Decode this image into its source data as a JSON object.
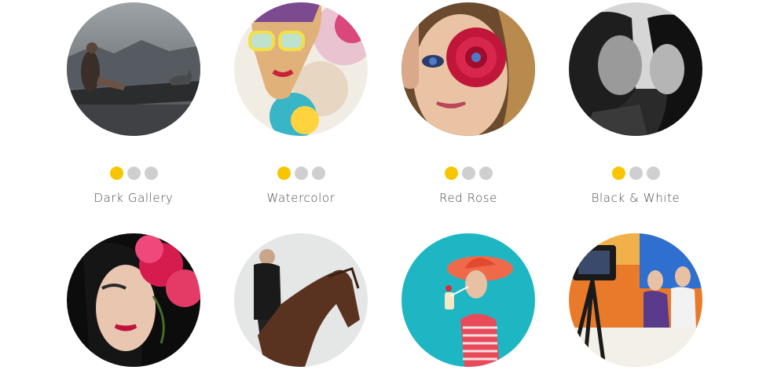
{
  "gallery": {
    "items": [
      {
        "label": "Dark Gallery",
        "image": "woman-on-log-in-rain",
        "active_dot": 0,
        "dots": 3
      },
      {
        "label": "Watercolor",
        "image": "watercolor-woman-with-glasses",
        "active_dot": 0,
        "dots": 3
      },
      {
        "label": "Red Rose",
        "image": "woman-with-rose-over-eye",
        "active_dot": 0,
        "dots": 3
      },
      {
        "label": "Black & White",
        "image": "couple-black-and-white",
        "active_dot": 0,
        "dots": 3
      },
      {
        "label": "",
        "image": "woman-with-pink-flowers",
        "active_dot": null,
        "dots": 0
      },
      {
        "label": "",
        "image": "man-on-horse",
        "active_dot": null,
        "dots": 0
      },
      {
        "label": "",
        "image": "woman-in-red-hat-drinking",
        "active_dot": null,
        "dots": 0
      },
      {
        "label": "",
        "image": "tv-studio-camera",
        "active_dot": null,
        "dots": 0
      }
    ]
  },
  "colors": {
    "accent": "#f7c600",
    "inactive_dot": "#cfcfcf",
    "label": "#4a4a4a"
  }
}
